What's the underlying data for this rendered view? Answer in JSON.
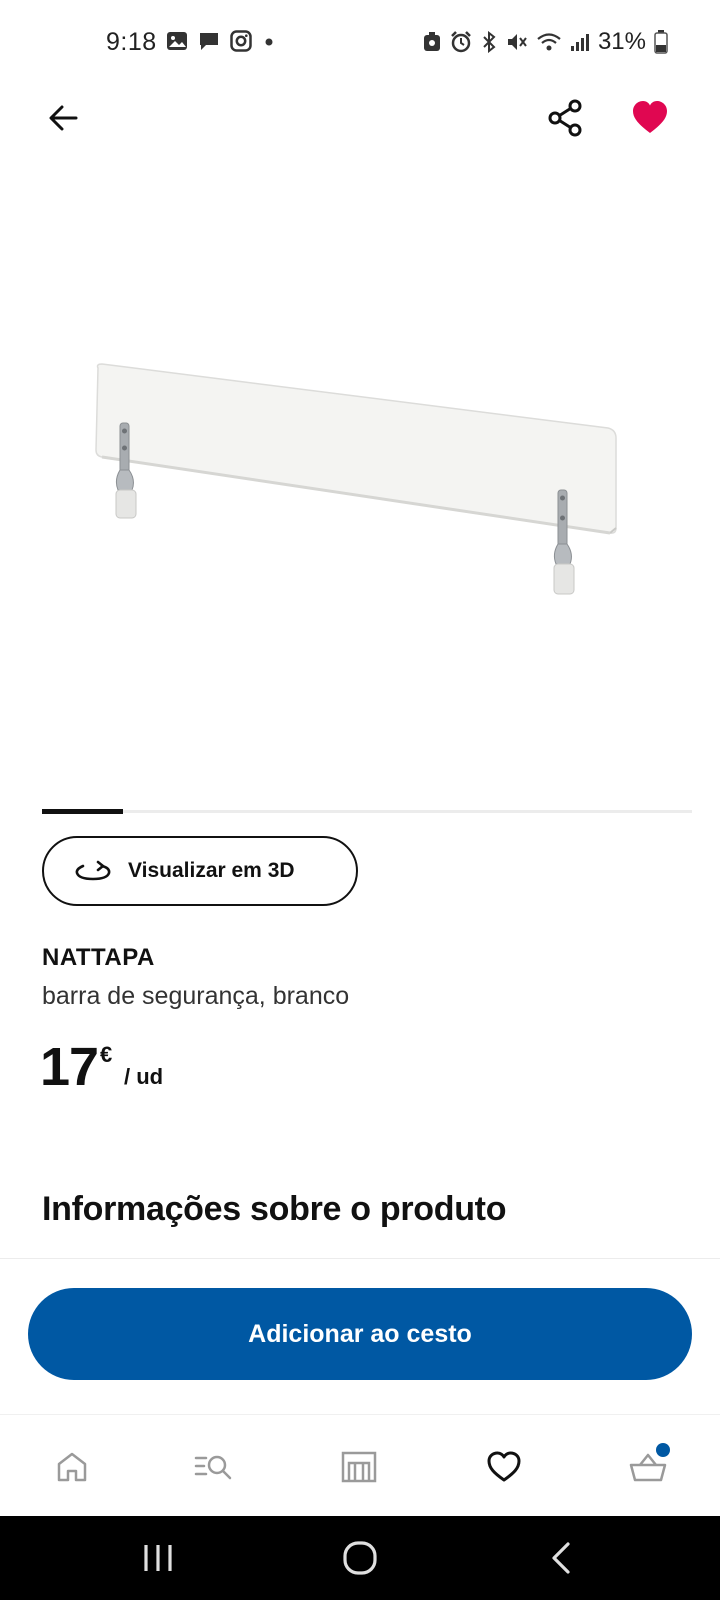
{
  "status_bar": {
    "time": "9:18",
    "left_icons": [
      "gallery-icon",
      "message-icon",
      "instagram-icon",
      "dot-icon"
    ],
    "right_icons": [
      "recycle-icon",
      "alarm-icon",
      "bluetooth-icon",
      "mute-icon",
      "wifi-icon",
      "signal-icon"
    ],
    "battery": "31%"
  },
  "app_bar": {
    "back_icon": "arrow-left-icon",
    "share_icon": "share-icon",
    "favorite_icon": "heart-filled-icon",
    "favorite_color": "#e00751"
  },
  "product": {
    "image_description_icon": "bed-guard-rail-image",
    "carousel_progress": 0.125,
    "view_3d_label": "Visualizar em 3D",
    "name": "NATTAPA",
    "description": "barra de segurança, branco",
    "price_value": "17",
    "price_currency": "€",
    "price_unit": "/ ud"
  },
  "info_heading": "Informações sobre o produto",
  "add_to_cart_label": "Adicionar ao cesto",
  "colors": {
    "primary": "#0058a3",
    "favorite": "#e00751",
    "text": "#111111"
  },
  "bottom_nav": [
    {
      "icon": "home-icon",
      "active": false
    },
    {
      "icon": "search-icon",
      "active": false
    },
    {
      "icon": "store-icon",
      "active": false
    },
    {
      "icon": "heart-icon",
      "active": true
    },
    {
      "icon": "basket-icon",
      "active": false,
      "badge": true
    }
  ],
  "system_nav": [
    "recents-icon",
    "home-circle-icon",
    "back-chevron-icon"
  ]
}
